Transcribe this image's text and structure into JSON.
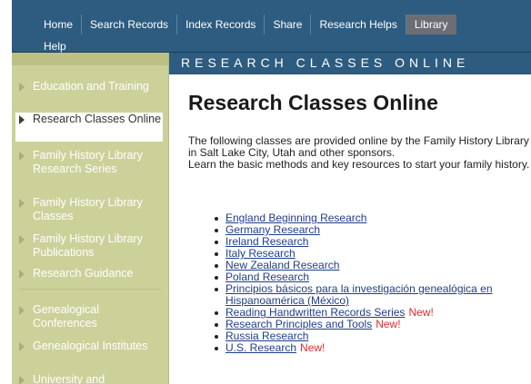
{
  "nav": {
    "row1": [
      {
        "label": "Home",
        "active": false
      },
      {
        "label": "Search Records",
        "active": false
      },
      {
        "label": "Index Records",
        "active": false
      },
      {
        "label": "Share",
        "active": false
      },
      {
        "label": "Research Helps",
        "active": false
      },
      {
        "label": "Library",
        "active": true
      }
    ],
    "row2": [
      {
        "label": "Help",
        "active": false
      }
    ]
  },
  "sidebar": {
    "items": [
      {
        "label": "Education and Training",
        "active": false
      },
      {
        "label": "Research Classes Online",
        "active": true
      },
      {
        "label": "Family History Library Research Series",
        "active": false
      },
      {
        "label": "Family History Library Classes",
        "active": false
      },
      {
        "label": "Family History Library Publications",
        "active": false
      },
      {
        "label": "Research Guidance",
        "active": false
      },
      {
        "label": "Genealogical Conferences",
        "active": false
      },
      {
        "label": "Genealogical Institutes",
        "active": false
      },
      {
        "label": "University and",
        "active": false
      }
    ]
  },
  "main": {
    "section_band": "RESEARCH CLASSES ONLINE",
    "title": "Research Classes Online",
    "intro_line1": "The following classes are provided online by the Family History Library in Salt Lake City, Utah and other sponsors.",
    "intro_line2": "Learn the basic methods and key resources to start your family history.",
    "classes": [
      {
        "label": "England Beginning Research",
        "new": ""
      },
      {
        "label": "Germany Research",
        "new": ""
      },
      {
        "label": "Ireland Research",
        "new": ""
      },
      {
        "label": "Italy Research",
        "new": ""
      },
      {
        "label": "New Zealand Research",
        "new": ""
      },
      {
        "label": "Poland Research",
        "new": ""
      },
      {
        "label": "Principios básicos para la investigación genealógica en Hispanoamérica (México)",
        "new": ""
      },
      {
        "label": "Reading Handwritten Records Series",
        "new": "New!"
      },
      {
        "label": "Research Principles and Tools",
        "new": "New!"
      },
      {
        "label": "Russia Research",
        "new": ""
      },
      {
        "label": "U.S. Research",
        "new": "New!"
      }
    ]
  },
  "colors": {
    "nav_bg": "#2d5c80",
    "sidebar_bg": "#ccd19a",
    "link": "#1f3d8a",
    "new_badge": "#e52b2b"
  }
}
